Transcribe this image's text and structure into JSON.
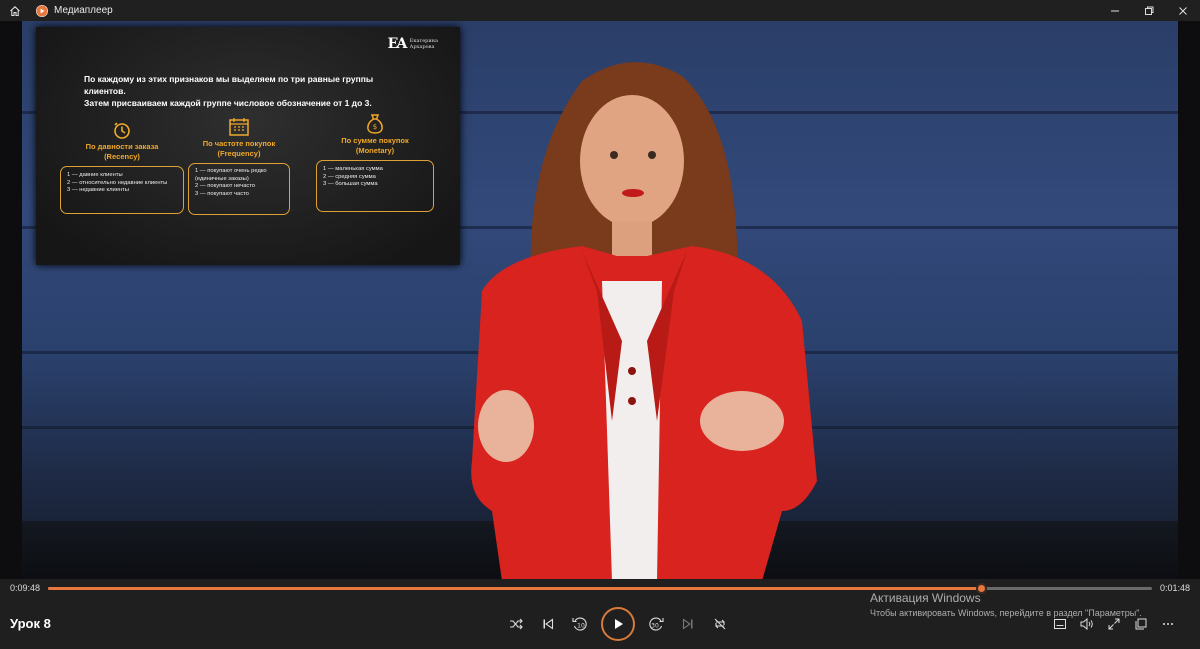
{
  "window": {
    "title": "Медиаплеер",
    "icons": {
      "home": "home-icon",
      "app": "play-circle-icon",
      "minimize": "minimize-icon",
      "maximize": "maximize-icon",
      "close": "close-icon"
    }
  },
  "video": {
    "slide": {
      "logo": {
        "mark": "ЕА",
        "name_line1": "Екатерина",
        "name_line2": "Архарова"
      },
      "line1": "По каждому из этих признаков мы выделяем по три равные группы клиентов.",
      "line2": "Затем присваиваем каждой группе числовое обозначение от 1 до 3.",
      "columns": [
        {
          "icon": "clock-icon",
          "title_ru": "По давности заказа",
          "title_en": "(Recency)",
          "items": [
            "1 — давние клиенты",
            "2 — относительно недавние клиенты",
            "3 — недавние клиенты"
          ]
        },
        {
          "icon": "calendar-icon",
          "title_ru": "По частоте покупок",
          "title_en": "(Frequency)",
          "items": [
            "1 — покупают очень редко",
            "(единичные заказы)",
            "2 — покупают нечасто",
            "3 — покупают часто"
          ]
        },
        {
          "icon": "money-bag-icon",
          "title_ru": "По сумме покупок",
          "title_en": "(Monetary)",
          "items": [
            "1 — маленькая сумма",
            "2 — средняя сумма",
            "3 — большая сумма"
          ]
        }
      ],
      "accent_color": "#f0a92a"
    }
  },
  "player": {
    "elapsed": "0:09:48",
    "remaining": "0:01:48",
    "progress_fraction": 0.845,
    "accent_color": "#e8773d",
    "track_title": "Урок 8",
    "controls": [
      "shuffle-icon",
      "previous-icon",
      "rewind-10-icon",
      "play-icon",
      "forward-30-icon",
      "next-icon",
      "repeat-off-icon"
    ],
    "skip_back_label": "10",
    "skip_forward_label": "30",
    "right_controls": [
      "subtitles-icon",
      "volume-icon",
      "fullscreen-icon",
      "mini-player-icon",
      "more-options-icon"
    ]
  },
  "watermark": {
    "title": "Активация Windows",
    "subtitle": "Чтобы активировать Windows, перейдите в раздел \"Параметры\"."
  }
}
